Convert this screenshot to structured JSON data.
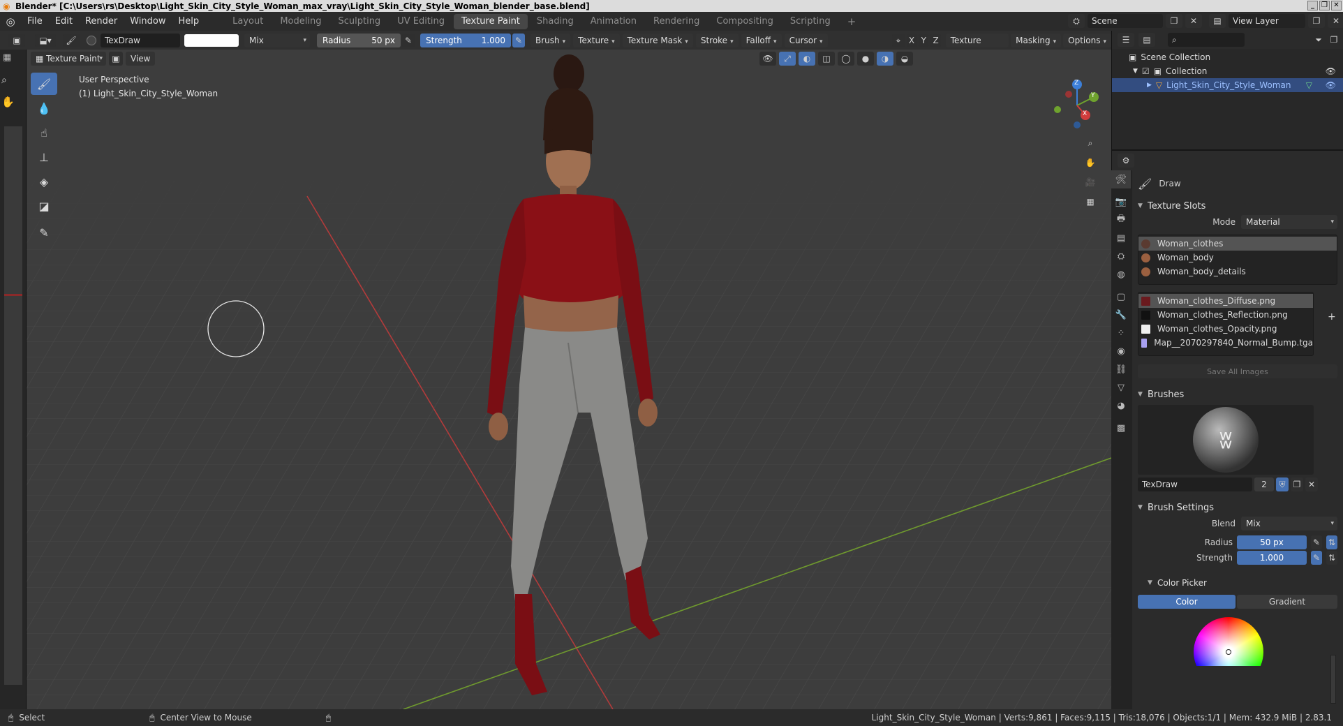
{
  "window": {
    "title": "Blender* [C:\\Users\\rs\\Desktop\\Light_Skin_City_Style_Woman_max_vray\\Light_Skin_City_Style_Woman_blender_base.blend]"
  },
  "menu": [
    "File",
    "Edit",
    "Render",
    "Window",
    "Help"
  ],
  "workspaces": [
    "Layout",
    "Modeling",
    "Sculpting",
    "UV Editing",
    "Texture Paint",
    "Shading",
    "Animation",
    "Rendering",
    "Compositing",
    "Scripting"
  ],
  "active_workspace": "Texture Paint",
  "scene": {
    "name": "Scene",
    "view_layer": "View Layer"
  },
  "toolhdr": {
    "brush_name": "TexDraw",
    "blend_mode": "Mix",
    "radius_label": "Radius",
    "radius_value": "50 px",
    "strength_label": "Strength",
    "strength_value": "1.000",
    "menus": [
      "Brush",
      "Texture",
      "Texture Mask",
      "Stroke",
      "Falloff",
      "Cursor"
    ],
    "axes": [
      "X",
      "Y",
      "Z"
    ],
    "right_menus": [
      "Texture Slots",
      "Masking",
      "Options"
    ]
  },
  "viewhdr": {
    "mode": "Texture Paint",
    "view": "View"
  },
  "viewport": {
    "perspective": "User Perspective",
    "object": "(1) Light_Skin_City_Style_Woman",
    "gizmo_labels": [
      "Z",
      "Y",
      "X"
    ]
  },
  "outliner": {
    "scene_collection": "Scene Collection",
    "collection": "Collection",
    "object": "Light_Skin_City_Style_Woman"
  },
  "props": {
    "tool_name": "Draw",
    "texture_slots": {
      "title": "Texture Slots",
      "mode_label": "Mode",
      "mode_value": "Material",
      "materials": [
        "Woman_clothes",
        "Woman_body",
        "Woman_body_details"
      ],
      "images": [
        "Woman_clothes_Diffuse.png",
        "Woman_clothes_Reflection.png",
        "Woman_clothes_Opacity.png",
        "Map__2070297840_Normal_Bump.tga"
      ],
      "save_button": "Save All Images"
    },
    "brushes": {
      "title": "Brushes",
      "brush_name": "TexDraw",
      "users": "2"
    },
    "brush_settings": {
      "title": "Brush Settings",
      "blend_label": "Blend",
      "blend_value": "Mix",
      "radius_label": "Radius",
      "radius_value": "50 px",
      "strength_label": "Strength",
      "strength_value": "1.000"
    },
    "color_picker": {
      "title": "Color Picker",
      "tabs": [
        "Color",
        "Gradient"
      ]
    }
  },
  "status": {
    "left_action": "Select",
    "middle_action": "Center View to Mouse",
    "stats": "Light_Skin_City_Style_Woman | Verts:9,861 | Faces:9,115 | Tris:18,076 | Objects:1/1 | Mem: 432.9 MiB | 2.83.1"
  },
  "colors": {
    "accent": "#4772b3",
    "shirt": "#8a1016",
    "pants": "#8a8a88",
    "grid_x": "#b33b3b",
    "grid_y": "#6f9a2e"
  }
}
